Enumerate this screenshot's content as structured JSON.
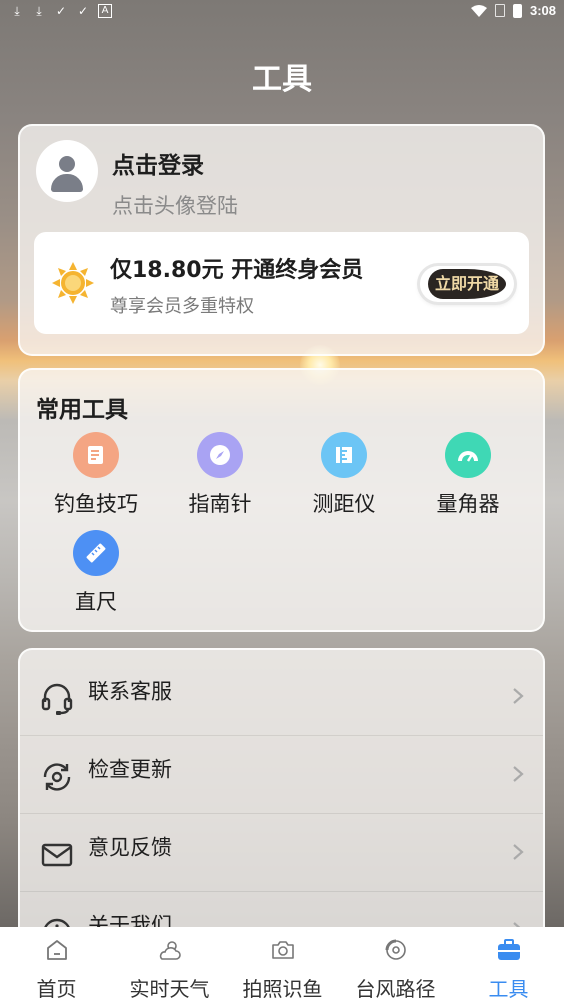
{
  "status_bar": {
    "time": "3:08"
  },
  "page": {
    "title": "工具"
  },
  "profile": {
    "login_title": "点击登录",
    "login_sub": "点击头像登陆"
  },
  "vip": {
    "title": "仅18.80元 开通终身会员",
    "sub": "尊享会员多重特权",
    "button": "立即开通"
  },
  "tools": {
    "title": "常用工具",
    "items": [
      {
        "label": "钓鱼技巧",
        "icon": "note-icon",
        "color": "#f4a583"
      },
      {
        "label": "指南针",
        "icon": "compass-icon",
        "color": "#a9a3f3"
      },
      {
        "label": "测距仪",
        "icon": "ruler-measure-icon",
        "color": "#6cc5f5"
      },
      {
        "label": "量角器",
        "icon": "protractor-icon",
        "color": "#3fd8b5"
      },
      {
        "label": "直尺",
        "icon": "ruler-icon",
        "color": "#4d90f4"
      }
    ]
  },
  "menu": {
    "items": [
      {
        "label": "联系客服",
        "icon": "headset-icon"
      },
      {
        "label": "检查更新",
        "icon": "refresh-icon"
      },
      {
        "label": "意见反馈",
        "icon": "mail-icon"
      },
      {
        "label": "关于我们",
        "icon": "info-icon"
      }
    ]
  },
  "nav": {
    "items": [
      {
        "label": "首页",
        "icon": "home-icon"
      },
      {
        "label": "实时天气",
        "icon": "weather-icon"
      },
      {
        "label": "拍照识鱼",
        "icon": "camera-icon"
      },
      {
        "label": "台风路径",
        "icon": "typhoon-icon"
      },
      {
        "label": "工具",
        "icon": "toolbox-icon"
      }
    ],
    "active_color": "#3a8cf0"
  }
}
